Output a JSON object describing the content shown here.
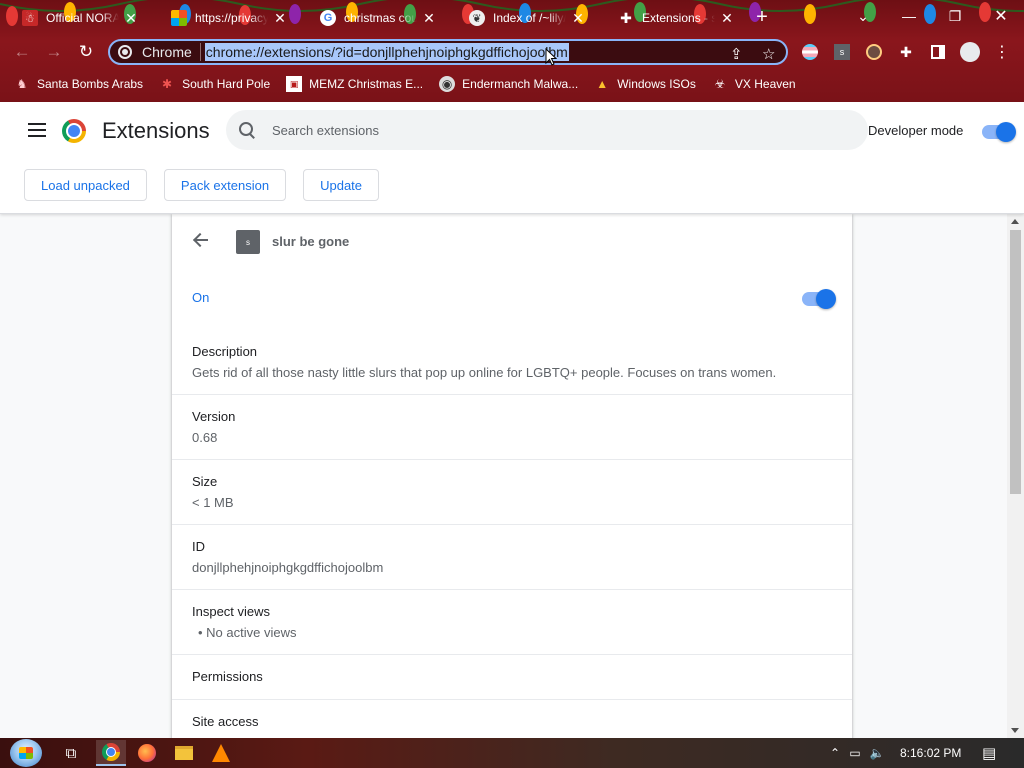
{
  "tabs": [
    {
      "title": "Official NORAD",
      "favicon": "santa-icon",
      "active": false
    },
    {
      "title": "https://privacy",
      "favicon": "microsoft-icon",
      "active": false
    },
    {
      "title": "christmas coun",
      "favicon": "google-icon",
      "active": false
    },
    {
      "title": "Index of /~lily/",
      "favicon": "dog-icon",
      "active": false
    },
    {
      "title": "Extensions - slu",
      "favicon": "puzzle-icon",
      "active": true
    }
  ],
  "omnibox": {
    "chip_label": "Chrome",
    "url": "chrome://extensions/?id=donjllphehjnoiphgkgdffichojoolbm"
  },
  "bookmarks": [
    {
      "label": "Santa Bombs Arabs",
      "icon": "santa-icon"
    },
    {
      "label": "South Hard Pole",
      "icon": "snowflake-icon"
    },
    {
      "label": "MEMZ Christmas E...",
      "icon": "memz-icon"
    },
    {
      "label": "Endermanch Malwa...",
      "icon": "raccoon-icon"
    },
    {
      "label": "Windows ISOs",
      "icon": "folder-icon"
    },
    {
      "label": "VX Heaven",
      "icon": "biohazard-icon"
    }
  ],
  "header": {
    "title": "Extensions",
    "search_placeholder": "Search extensions",
    "developer_mode_label": "Developer mode",
    "developer_mode_on": true
  },
  "actions": {
    "load_unpacked": "Load unpacked",
    "pack_extension": "Pack extension",
    "update": "Update"
  },
  "extension": {
    "icon_letter": "s",
    "name": "slur be gone",
    "status_label": "On",
    "enabled": true,
    "description_label": "Description",
    "description": "Gets rid of all those nasty little slurs that pop up online for LGBTQ+ people. Focuses on trans women.",
    "version_label": "Version",
    "version": "0.68",
    "size_label": "Size",
    "size": "< 1 MB",
    "id_label": "ID",
    "id": "donjllphehjnoiphgkgdffichojoolbm",
    "inspect_label": "Inspect views",
    "inspect_views": [
      "No active views"
    ],
    "permissions_label": "Permissions",
    "site_access_label": "Site access"
  },
  "taskbar": {
    "apps": [
      "task-view-icon",
      "chrome-icon",
      "firefox-icon",
      "file-explorer-icon",
      "vlc-icon"
    ],
    "clock": "8:16:02 PM"
  },
  "colors": {
    "frame": "#7a1218",
    "accent": "#1a73e8",
    "url_highlight": "#a8c7fa"
  }
}
